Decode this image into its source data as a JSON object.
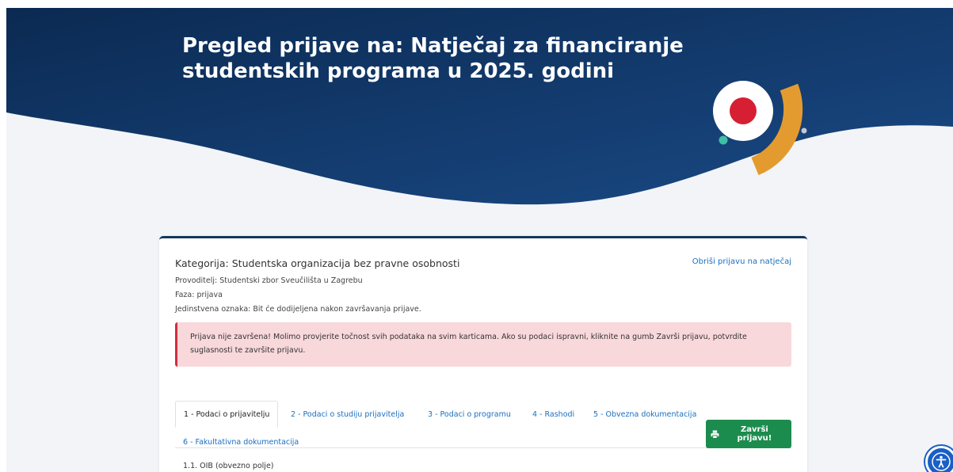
{
  "header": {
    "title": "Pregled prijave na: Natječaj za financiranje studentskih programa u 2025. godini"
  },
  "application": {
    "category": "Kategorija: Studentska organizacija bez pravne osobnosti",
    "delete_link": "Obriši prijavu na natječaj",
    "provider": "Provoditelj: Studentski zbor Sveučilišta u Zagrebu",
    "phase": "Faza: prijava",
    "identifier": "Jedinstvena oznaka: Bit će dodijeljena nakon završavanja prijave."
  },
  "alert": {
    "text": "Prijava nije završena! Molimo provjerite točnost svih podataka na svim karticama. Ako su podaci ispravni, kliknite na gumb Završi prijavu, potvrdite suglasnosti te završite prijavu."
  },
  "tabs": [
    {
      "label": "1 - Podaci o prijavitelju",
      "active": true
    },
    {
      "label": "2 - Podaci o studiju prijavitelja",
      "active": false
    },
    {
      "label": "3 - Podaci o programu",
      "active": false
    },
    {
      "label": "4 - Rashodi",
      "active": false
    },
    {
      "label": "5 - Obvezna dokumentacija",
      "active": false
    },
    {
      "label": "6 - Fakultativna dokumentacija",
      "active": false
    }
  ],
  "finish_button": {
    "label": "Završi prijavu!",
    "icon": "printer-icon"
  },
  "form": {
    "first_field_label": "1.1. OIB (obvezno polje)"
  },
  "accessibility": {
    "icon": "accessibility-icon"
  },
  "colors": {
    "header_dark": "#0b2a52",
    "header_light": "#1a4a86",
    "accent_red": "#d71f33",
    "accent_orange": "#e39b2f",
    "accent_teal": "#3fbfa4",
    "link_blue": "#1a6fc1",
    "success_green": "#1c8c4e",
    "alert_bg": "#f8d8db",
    "alert_border": "#d22d3d"
  }
}
